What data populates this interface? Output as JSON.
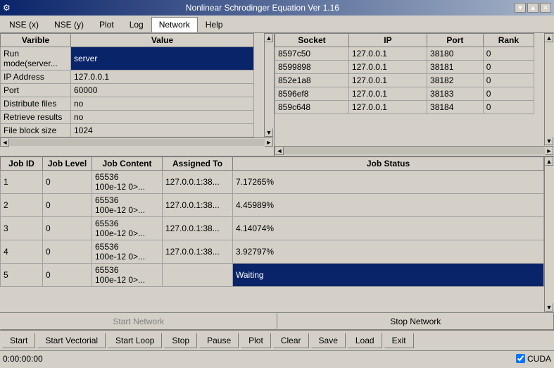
{
  "window": {
    "title": "Nonlinear Schrodinger Equation Ver 1.16",
    "icon": "⚙"
  },
  "titlebar": {
    "minimize": "▼",
    "maximize": "▲",
    "close": "✕"
  },
  "menu": {
    "items": [
      {
        "label": "NSE (x)",
        "active": false
      },
      {
        "label": "NSE (y)",
        "active": false
      },
      {
        "label": "Plot",
        "active": false
      },
      {
        "label": "Log",
        "active": false
      },
      {
        "label": "Network",
        "active": true
      },
      {
        "label": "Help",
        "active": false
      }
    ]
  },
  "left_table": {
    "headers": [
      "Varible",
      "Value"
    ],
    "rows": [
      {
        "varible": "Run mode(server...",
        "value": "server"
      },
      {
        "varible": "IP Address",
        "value": "127.0.0.1"
      },
      {
        "varible": "Port",
        "value": "60000"
      },
      {
        "varible": "Distribute files",
        "value": "no"
      },
      {
        "varible": "Retrieve results",
        "value": "no"
      },
      {
        "varible": "File block size",
        "value": "1024"
      }
    ]
  },
  "right_table": {
    "headers": [
      "Socket",
      "IP",
      "Port",
      "Rank"
    ],
    "rows": [
      {
        "socket": "8597c50",
        "ip": "127.0.0.1",
        "port": "38180",
        "rank": "0"
      },
      {
        "socket": "8599898",
        "ip": "127.0.0.1",
        "port": "38181",
        "rank": "0"
      },
      {
        "socket": "852e1a8",
        "ip": "127.0.0.1",
        "port": "38182",
        "rank": "0"
      },
      {
        "socket": "8596ef8",
        "ip": "127.0.0.1",
        "port": "38183",
        "rank": "0"
      },
      {
        "socket": "859c648",
        "ip": "127.0.0.1",
        "port": "38184",
        "rank": "0"
      }
    ]
  },
  "job_table": {
    "headers": [
      "Job ID",
      "Job Level",
      "Job Content",
      "Assigned To",
      "Job Status"
    ],
    "rows": [
      {
        "id": "1",
        "level": "0",
        "content": "65536\n100e-12 0>...",
        "assigned": "127.0.0.1:38...",
        "status": "7.17265%",
        "waiting": false
      },
      {
        "id": "2",
        "level": "0",
        "content": "65536\n100e-12 0>...",
        "assigned": "127.0.0.1:38...",
        "status": "4.45989%",
        "waiting": false
      },
      {
        "id": "3",
        "level": "0",
        "content": "65536\n100e-12 0>...",
        "assigned": "127.0.0.1:38...",
        "status": "4.14074%",
        "waiting": false
      },
      {
        "id": "4",
        "level": "0",
        "content": "65536\n100e-12 0>...",
        "assigned": "127.0.0.1:38...",
        "status": "3.92797%",
        "waiting": false
      },
      {
        "id": "5",
        "level": "0",
        "content": "65536\n100e-12 0>...",
        "assigned": "",
        "status": "Waiting",
        "waiting": true
      }
    ]
  },
  "network_buttons": {
    "start": "Start Network",
    "stop": "Stop Network"
  },
  "bottom_buttons": [
    "Start",
    "Start Vectorial",
    "Start Loop",
    "Stop",
    "Pause",
    "Plot",
    "Clear",
    "Save",
    "Load",
    "Exit"
  ],
  "status_bar": {
    "time": "0:00:00:00",
    "cuda_label": "CUDA",
    "cuda_checked": true
  }
}
